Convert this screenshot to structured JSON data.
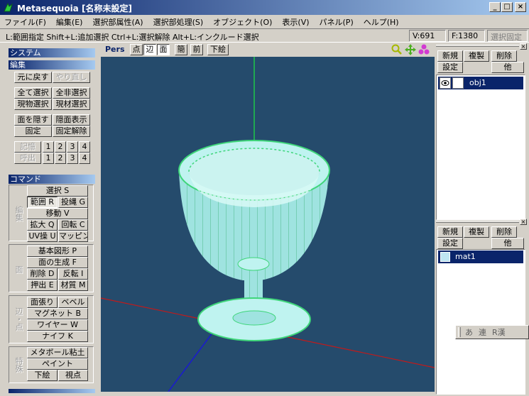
{
  "window": {
    "title": "Metasequoia [名称未設定]",
    "min": "_",
    "max": "□",
    "close": "×"
  },
  "menu": [
    {
      "label": "ファイル(F)"
    },
    {
      "label": "編集(E)"
    },
    {
      "label": "選択部属性(A)"
    },
    {
      "label": "選択部処理(S)"
    },
    {
      "label": "オブジェクト(O)"
    },
    {
      "label": "表示(V)"
    },
    {
      "label": "パネル(P)"
    },
    {
      "label": "ヘルプ(H)"
    }
  ],
  "status": {
    "hint": "L:範囲指定  Shift+L:追加選択  Ctrl+L:選択解除  Alt+L:インクルード選択",
    "vertices": "V:691",
    "faces": "F:1380",
    "lock": "選択固定"
  },
  "left": {
    "system": "システム",
    "edit": "編集",
    "undo": "元に戻す",
    "redo": "やり直し",
    "select_all": "全て選択",
    "deselect_all": "全非選択",
    "select_obj": "現物選択",
    "select_mat": "現材選択",
    "hide_face": "面を隠す",
    "show_hidden": "隠面表示",
    "fix": "固定",
    "unfix": "固定解除",
    "memory": "記憶",
    "recall": "呼出",
    "slot1": "1",
    "slot2": "2",
    "slot3": "3",
    "slot4": "4",
    "command": "コマンド",
    "edit_group": "編集",
    "cmd_select": "選択 S",
    "cmd_range": "範囲 R",
    "cmd_lasso": "投縄 G",
    "cmd_move": "移動 V",
    "cmd_scale": "拡大 Q",
    "cmd_rotate": "回転 C",
    "cmd_uv": "UV操 U",
    "cmd_mapping": "マッピング",
    "face_group": "面",
    "cmd_primitive": "基本図形 P",
    "cmd_face_gen": "面の生成 F",
    "cmd_delete": "削除 D",
    "cmd_flip": "反転 I",
    "cmd_extrude": "押出 E",
    "cmd_material": "材質 M",
    "edge_group": "辺・点",
    "cmd_stretch": "面張り",
    "cmd_bevel": "ベベル",
    "cmd_magnet": "マグネット B",
    "cmd_wire": "ワイヤー W",
    "cmd_knife": "ナイフ K",
    "special_group": "特殊",
    "cmd_metaball": "メタボール粘土",
    "cmd_paint": "ペイント",
    "cmd_sketch": "下絵",
    "cmd_viewpoint": "視点"
  },
  "viewport": {
    "mode": "Pers",
    "vertex": "点",
    "edge": "辺",
    "face": "面",
    "simple": "簡",
    "front": "前",
    "sketch": "下絵"
  },
  "objects": {
    "new": "新規",
    "dup": "複製",
    "del": "削除",
    "settings": "設定",
    "other": "他",
    "items": [
      {
        "name": "obj1"
      }
    ]
  },
  "materials": {
    "new": "新規",
    "dup": "複製",
    "del": "削除",
    "settings": "設定",
    "other": "他",
    "items": [
      {
        "name": "mat1"
      }
    ]
  },
  "ime": {
    "a": "あ",
    "ren": "連",
    "r": "R漢"
  },
  "colors": {
    "viewport_bg": "#254b6c",
    "mesh": "#bff3f0",
    "wire": "#3fd67a",
    "axis_y": "#1ec84a",
    "axis_x": "#c21a1a",
    "axis_z": "#1a1ad0"
  }
}
